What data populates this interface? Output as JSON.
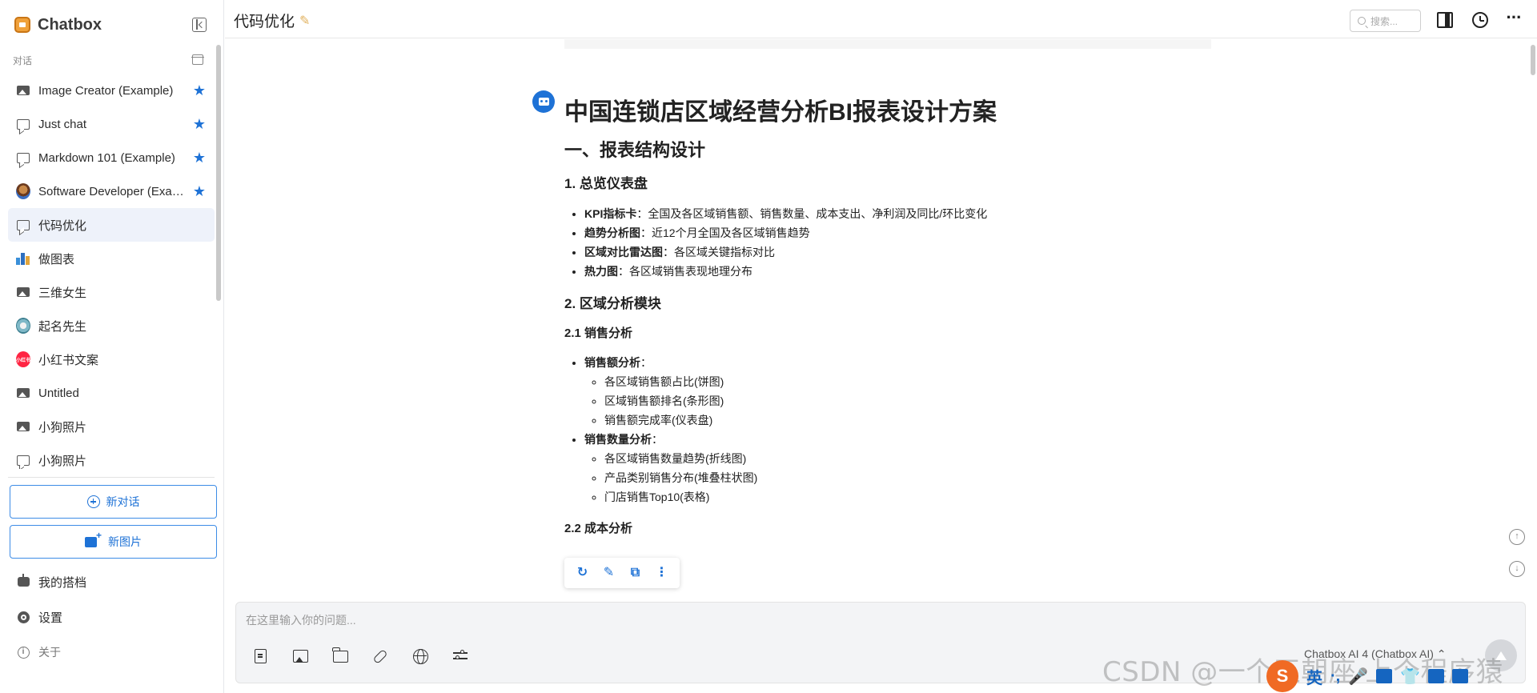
{
  "app": {
    "name": "Chatbox"
  },
  "sidebar": {
    "section_label": "对话",
    "conversations": [
      {
        "label": "Image Creator (Example)",
        "icon": "image-icon",
        "starred": true
      },
      {
        "label": "Just chat",
        "icon": "chat-icon",
        "starred": true
      },
      {
        "label": "Markdown 101 (Example)",
        "icon": "chat-icon",
        "starred": true
      },
      {
        "label": "Software Developer (Example)",
        "icon": "avatar-icon",
        "starred": true
      },
      {
        "label": "代码优化",
        "icon": "chat-icon",
        "starred": false,
        "active": true
      },
      {
        "label": "做图表",
        "icon": "bar-chart-icon",
        "starred": false
      },
      {
        "label": "三维女生",
        "icon": "image-icon",
        "starred": false
      },
      {
        "label": "起名先生",
        "icon": "avatar-icon",
        "starred": false
      },
      {
        "label": "小红书文案",
        "icon": "xiaohongshu-icon",
        "starred": false,
        "icon_text": "小红书"
      },
      {
        "label": "Untitled",
        "icon": "image-icon",
        "starred": false
      },
      {
        "label": "小狗照片",
        "icon": "image-icon",
        "starred": false
      },
      {
        "label": "小狗照片",
        "icon": "chat-icon",
        "starred": false
      }
    ],
    "new_chat_label": "新对话",
    "new_image_label": "新图片",
    "my_copilots_label": "我的搭档",
    "settings_label": "设置",
    "about_label": "关于"
  },
  "header": {
    "title": "代码优化",
    "search_placeholder": "搜索..."
  },
  "message": {
    "h1": "中国连锁店区域经营分析BI报表设计方案",
    "section1_title": "一、报表结构设计",
    "sub1_title": "1. 总览仪表盘",
    "sub1_items": [
      {
        "bold": "KPI指标卡",
        "text": "：全国及各区域销售额、销售数量、成本支出、净利润及同比/环比变化"
      },
      {
        "bold": "趋势分析图",
        "text": "：近12个月全国及各区域销售趋势"
      },
      {
        "bold": "区域对比雷达图",
        "text": "：各区域关键指标对比"
      },
      {
        "bold": "热力图",
        "text": "：各区域销售表现地理分布"
      }
    ],
    "sub2_title": "2. 区域分析模块",
    "sub21_title": "2.1 销售分析",
    "sales_amount": {
      "bold": "销售额分析",
      "text": "：",
      "items": [
        "各区域销售额占比(饼图)",
        "区域销售额排名(条形图)",
        "销售额完成率(仪表盘)"
      ]
    },
    "sales_qty": {
      "bold": "销售数量分析",
      "text": "：",
      "items": [
        "各区域销售数量趋势(折线图)",
        "产品类别销售分布(堆叠柱状图)",
        "门店销售Top10(表格)"
      ]
    },
    "sub22_partial": "2.2 成本分析"
  },
  "input": {
    "placeholder": "在这里输入你的问题...",
    "model": "Chatbox AI 4 (Chatbox AI)"
  },
  "overlay": {
    "watermark": "CSDN @一个王朝座 上个程序猿",
    "ime_lang": "英"
  },
  "colors": {
    "accent": "#1e72d6",
    "active_bg": "#eef2fa"
  }
}
